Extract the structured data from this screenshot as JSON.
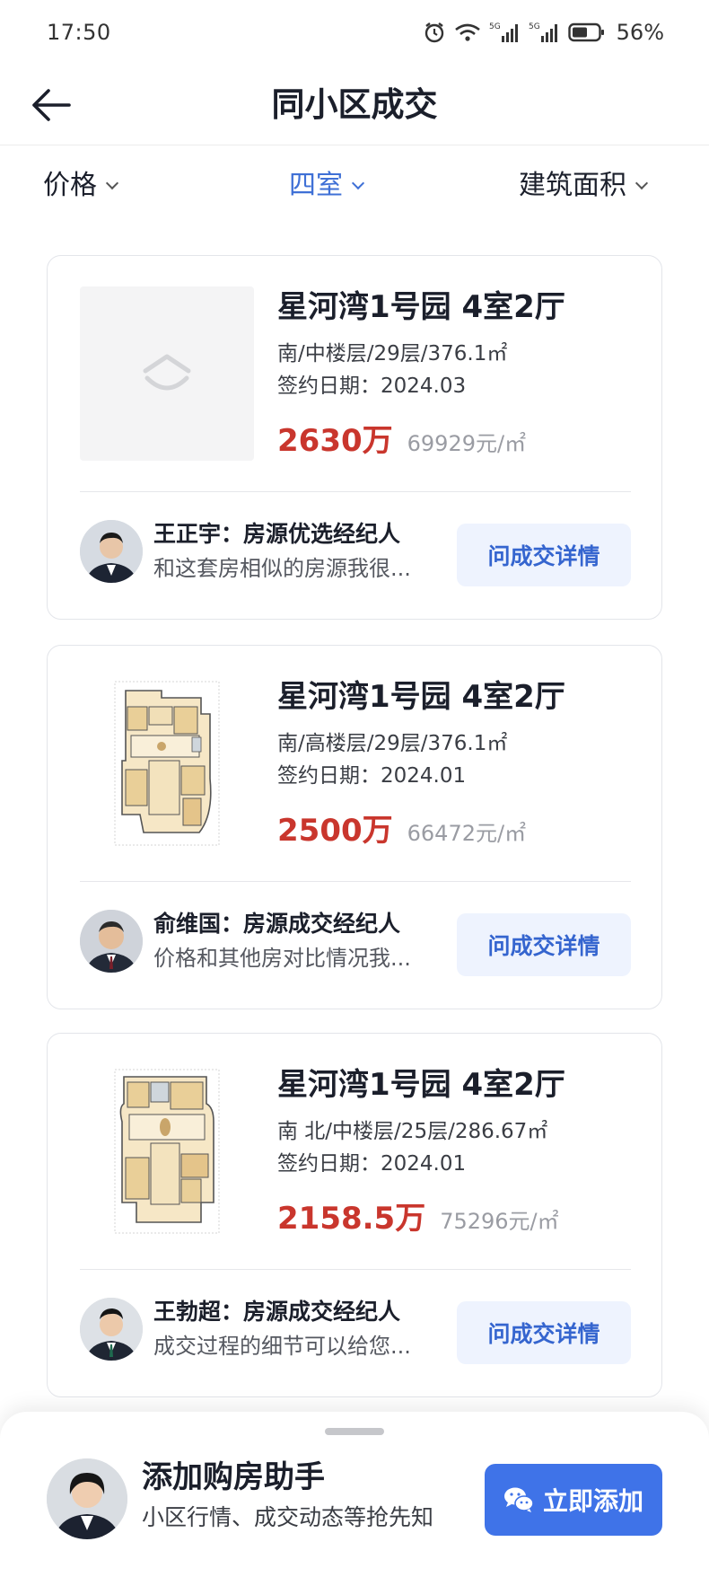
{
  "status_bar": {
    "time": "17:50",
    "battery_percent": "56%",
    "icons": [
      "alarm-icon",
      "wifi-icon",
      "signal-5g-icon",
      "signal-5g-icon",
      "battery-icon"
    ]
  },
  "header": {
    "title": "同小区成交",
    "back_icon": "back-arrow-icon"
  },
  "filters": [
    {
      "label": "价格",
      "active": false
    },
    {
      "label": "四室",
      "active": true
    },
    {
      "label": "建筑面积",
      "active": false
    }
  ],
  "listings": [
    {
      "title": "星河湾1号园 4室2厅",
      "meta": "南/中楼层/29层/376.1㎡",
      "sign_date": "签约日期：2024.03",
      "price": "2630万",
      "unit_price": "69929元/㎡",
      "image": "placeholder-logo",
      "agent": {
        "label": "王正宇：房源优选经纪人",
        "message": "和这套房相似的房源我很..."
      },
      "ask_label": "问成交详情"
    },
    {
      "title": "星河湾1号园 4室2厅",
      "meta": "南/高楼层/29层/376.1㎡",
      "sign_date": "签约日期：2024.01",
      "price": "2500万",
      "unit_price": "66472元/㎡",
      "image": "floor-plan",
      "agent": {
        "label": "俞维国：房源成交经纪人",
        "message": "价格和其他房对比情况我..."
      },
      "ask_label": "问成交详情"
    },
    {
      "title": "星河湾1号园 4室2厅",
      "meta": "南 北/中楼层/25层/286.67㎡",
      "sign_date": "签约日期：2024.01",
      "price": "2158.5万",
      "unit_price": "75296元/㎡",
      "image": "floor-plan",
      "agent": {
        "label": "王勃超：房源成交经纪人",
        "message": "成交过程的细节可以给您..."
      },
      "ask_label": "问成交详情"
    }
  ],
  "assistant": {
    "title": "添加购房助手",
    "subtitle": "小区行情、成交动态等抢先知",
    "button_label": "立即添加",
    "button_icon": "wechat-icon"
  },
  "colors": {
    "accent": "#3f73e8",
    "price_red": "#c9362d",
    "ask_bg": "#eef3fe",
    "active_filter": "#3f70d6"
  }
}
